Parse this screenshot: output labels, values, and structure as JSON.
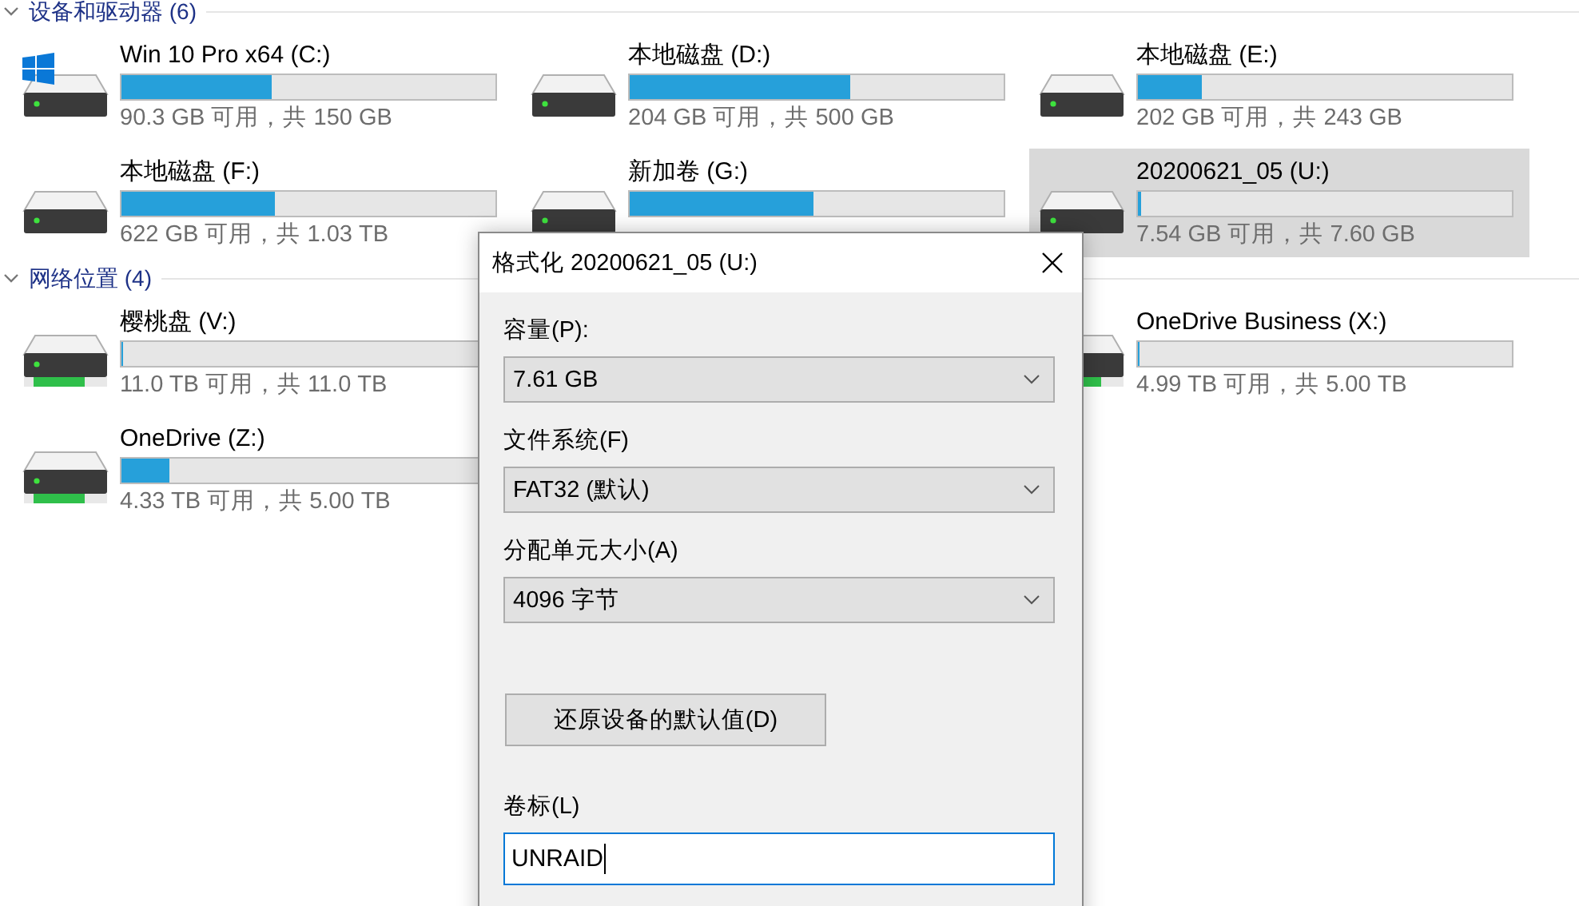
{
  "sections": [
    {
      "title": "设备和驱动器 (6)",
      "expanded": true,
      "drives": [
        {
          "name": "Win 10 Pro x64 (C:)",
          "kind": "local",
          "system": true,
          "selected": false,
          "level": 0.4,
          "reading": "90.3 GB 可用，共 150 GB"
        },
        {
          "name": "本地磁盘 (D:)",
          "kind": "local",
          "system": false,
          "selected": false,
          "level": 0.59,
          "reading": "204 GB 可用，共 500 GB"
        },
        {
          "name": "本地磁盘 (E:)",
          "kind": "local",
          "system": false,
          "selected": false,
          "level": 0.17,
          "reading": "202 GB 可用，共 243 GB"
        },
        {
          "name": "本地磁盘 (F:)",
          "kind": "local",
          "system": false,
          "selected": false,
          "level": 0.41,
          "reading": "622 GB 可用，共 1.03 TB"
        },
        {
          "name": "新加卷 (G:)",
          "kind": "local",
          "system": false,
          "selected": false,
          "level": 0.49
        },
        {
          "name": "20200621_05 (U:)",
          "kind": "local",
          "system": false,
          "selected": true,
          "level": 0.01,
          "reading": "7.54 GB 可用，共 7.60 GB"
        }
      ]
    },
    {
      "title": "网络位置 (4)",
      "expanded": true,
      "drives": [
        {
          "name": "樱桃盘 (V:)",
          "kind": "network",
          "system": false,
          "selected": false,
          "level": 0.004,
          "reading": "11.0 TB 可用，共 11.0 TB"
        },
        {
          "name": "OneDrive Business (X:)",
          "kind": "network",
          "system": false,
          "selected": false,
          "level": 0.004,
          "reading": "4.99 TB 可用，共 5.00 TB"
        },
        {
          "name": "OneDrive (Z:)",
          "kind": "network",
          "system": false,
          "selected": false,
          "level": 0.13,
          "reading": "4.33 TB 可用，共 5.00 TB"
        }
      ]
    }
  ],
  "dialog": {
    "title": "格式化 20200621_05 (U:)",
    "fields": [
      {
        "kind": "dropdown",
        "label": "容量(P):",
        "value": "7.61 GB"
      },
      {
        "kind": "dropdown",
        "label": "文件系统(F)",
        "value": "FAT32 (默认)"
      },
      {
        "kind": "dropdown",
        "label": "分配单元大小(A)",
        "value": "4096 字节"
      },
      {
        "kind": "button",
        "label": "还原设备的默认值(D)"
      },
      {
        "kind": "text",
        "label": "卷标(L)",
        "value": "UNRAID"
      }
    ]
  }
}
